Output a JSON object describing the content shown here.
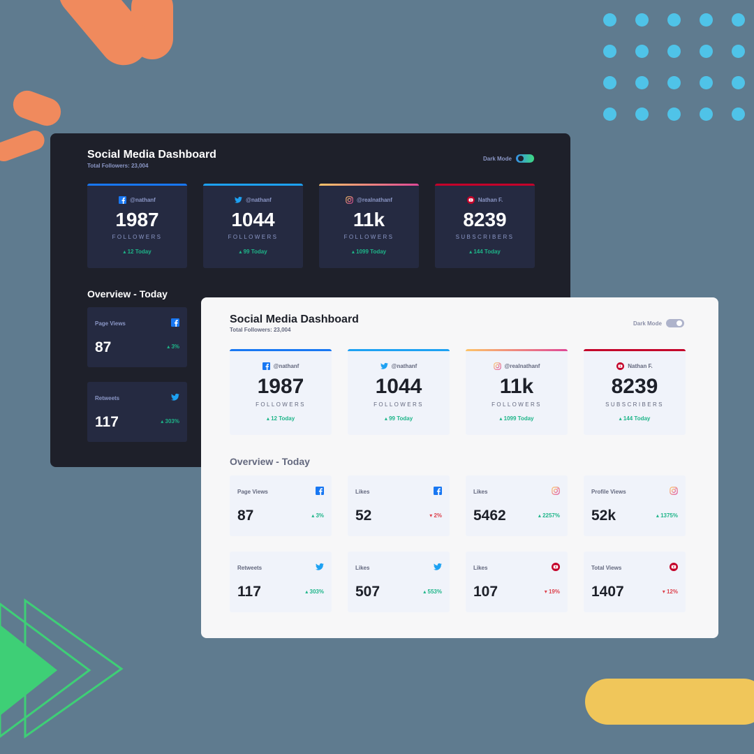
{
  "colors": {
    "background": "#5f7b8f",
    "facebook": "#1877f2",
    "twitter": "#1da1f2",
    "instagram_start": "#fdc468",
    "instagram_end": "#df4996",
    "youtube": "#c4032a",
    "up": "#1eb589",
    "down": "#dc414c",
    "dark_bg": "#1e202a",
    "dark_card": "#252a41",
    "light_bg": "#f7f7f8",
    "light_card": "#f0f3fa"
  },
  "dark": {
    "title": "Social Media Dashboard",
    "subtitle": "Total Followers: 23,004",
    "toggle_label": "Dark Mode",
    "cards": [
      {
        "icon": "facebook-icon",
        "handle": "@nathanf",
        "count": "1987",
        "unit": "FOLLOWERS",
        "change": "12 Today",
        "trend": "up"
      },
      {
        "icon": "twitter-icon",
        "handle": "@nathanf",
        "count": "1044",
        "unit": "FOLLOWERS",
        "change": "99 Today",
        "trend": "up"
      },
      {
        "icon": "instagram-icon",
        "handle": "@realnathanf",
        "count": "11k",
        "unit": "FOLLOWERS",
        "change": "1099 Today",
        "trend": "up"
      },
      {
        "icon": "youtube-icon",
        "handle": "Nathan F.",
        "count": "8239",
        "unit": "SUBSCRIBERS",
        "change": "144 Today",
        "trend": "up"
      }
    ],
    "overview_title": "Overview - Today",
    "overview": [
      {
        "label": "Page Views",
        "icon": "facebook-icon",
        "value": "87",
        "change": "3%",
        "trend": "up"
      },
      {
        "label": "Retweets",
        "icon": "twitter-icon",
        "value": "117",
        "change": "303%",
        "trend": "up"
      }
    ]
  },
  "light": {
    "title": "Social Media Dashboard",
    "subtitle": "Total Followers: 23,004",
    "toggle_label": "Dark Mode",
    "cards": [
      {
        "icon": "facebook-icon",
        "handle": "@nathanf",
        "count": "1987",
        "unit": "FOLLOWERS",
        "change": "12 Today",
        "trend": "up"
      },
      {
        "icon": "twitter-icon",
        "handle": "@nathanf",
        "count": "1044",
        "unit": "FOLLOWERS",
        "change": "99 Today",
        "trend": "up"
      },
      {
        "icon": "instagram-icon",
        "handle": "@realnathanf",
        "count": "11k",
        "unit": "FOLLOWERS",
        "change": "1099 Today",
        "trend": "up"
      },
      {
        "icon": "youtube-icon",
        "handle": "Nathan F.",
        "count": "8239",
        "unit": "SUBSCRIBERS",
        "change": "144 Today",
        "trend": "up"
      }
    ],
    "overview_title": "Overview - Today",
    "overview": [
      {
        "label": "Page Views",
        "icon": "facebook-icon",
        "value": "87",
        "change": "3%",
        "trend": "up"
      },
      {
        "label": "Likes",
        "icon": "facebook-icon",
        "value": "52",
        "change": "2%",
        "trend": "down"
      },
      {
        "label": "Likes",
        "icon": "instagram-icon",
        "value": "5462",
        "change": "2257%",
        "trend": "up"
      },
      {
        "label": "Profile Views",
        "icon": "instagram-icon",
        "value": "52k",
        "change": "1375%",
        "trend": "up"
      },
      {
        "label": "Retweets",
        "icon": "twitter-icon",
        "value": "117",
        "change": "303%",
        "trend": "up"
      },
      {
        "label": "Likes",
        "icon": "twitter-icon",
        "value": "507",
        "change": "553%",
        "trend": "up"
      },
      {
        "label": "Likes",
        "icon": "youtube-icon",
        "value": "107",
        "change": "19%",
        "trend": "down"
      },
      {
        "label": "Total Views",
        "icon": "youtube-icon",
        "value": "1407",
        "change": "12%",
        "trend": "down"
      }
    ]
  }
}
